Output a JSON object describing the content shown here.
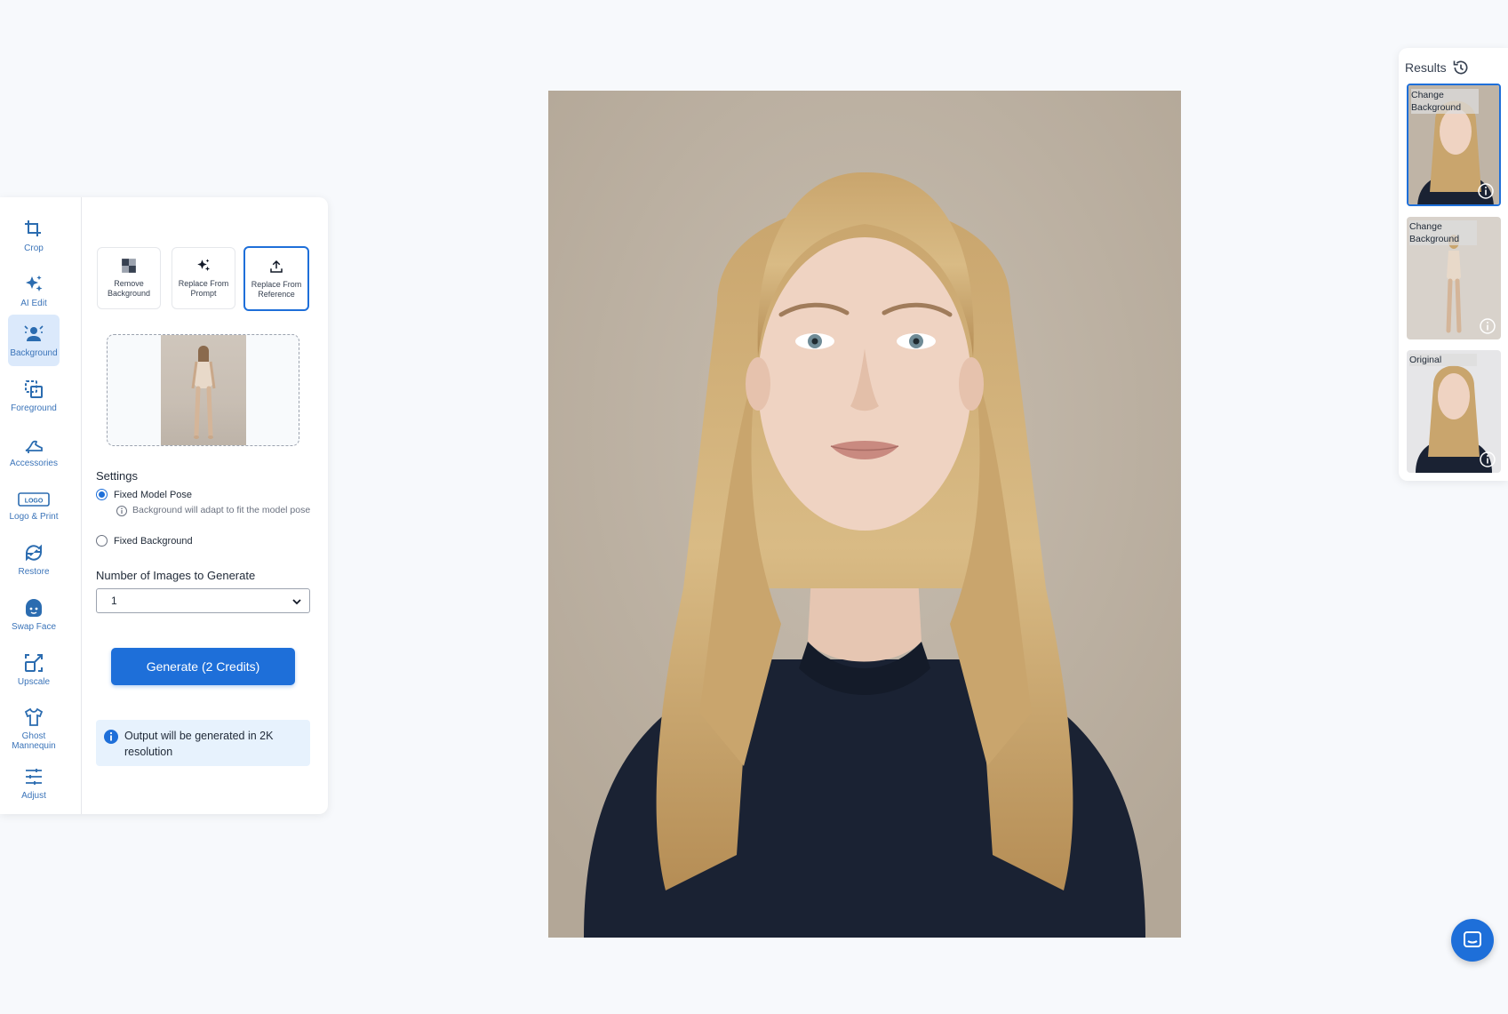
{
  "sidebar": {
    "items": [
      {
        "label": "Crop",
        "icon": "crop-icon"
      },
      {
        "label": "AI Edit",
        "icon": "sparkles-icon"
      },
      {
        "label": "Background",
        "icon": "background-icon"
      },
      {
        "label": "Foreground",
        "icon": "foreground-icon"
      },
      {
        "label": "Accessories",
        "icon": "shoe-icon"
      },
      {
        "label": "Logo & Print",
        "icon": "logo-icon"
      },
      {
        "label": "Restore",
        "icon": "restore-icon"
      },
      {
        "label": "Swap Face",
        "icon": "face-icon"
      },
      {
        "label": "Upscale",
        "icon": "upscale-icon"
      },
      {
        "label": "Ghost Mannequin",
        "icon": "shirt-icon"
      },
      {
        "label": "Adjust",
        "icon": "sliders-icon"
      }
    ],
    "active": "Background"
  },
  "panel": {
    "modes": [
      {
        "label": "Remove Background",
        "icon": "checker-icon"
      },
      {
        "label": "Replace From Prompt",
        "icon": "sparkles-icon"
      },
      {
        "label": "Replace From Reference",
        "icon": "upload-icon"
      }
    ],
    "selected_mode": "Replace From Reference",
    "settings_title": "Settings",
    "options": [
      {
        "label": "Fixed Model Pose",
        "checked": true
      },
      {
        "label": "Fixed Background",
        "checked": false
      }
    ],
    "pose_hint": "Background will adapt to fit the model pose",
    "num_images_label": "Number of Images to Generate",
    "num_images_value": "1",
    "generate_label": "Generate (2 Credits)",
    "info_text": "Output will be generated in 2K resolution"
  },
  "results": {
    "title": "Results",
    "items": [
      {
        "label": "Change Background",
        "active": true
      },
      {
        "label": "Change Background",
        "active": false
      },
      {
        "label": "Original",
        "active": false
      }
    ]
  },
  "colors": {
    "accent": "#1e6fd9",
    "rail_text": "#3b74b9",
    "active_bg": "#dbe9fb",
    "info_bg": "#e7f2fd"
  }
}
